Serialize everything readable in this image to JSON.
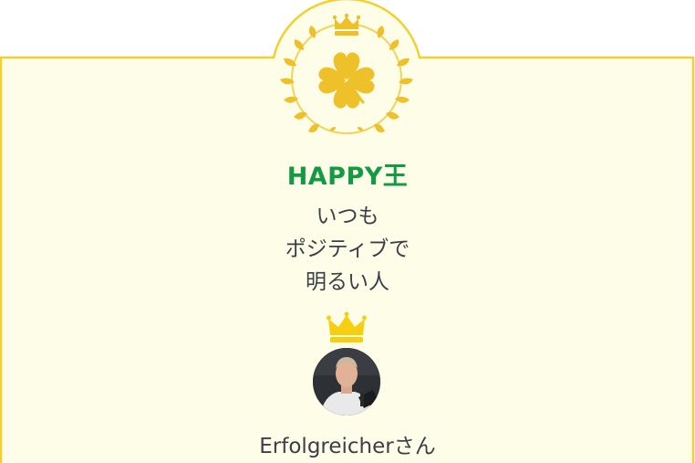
{
  "award": {
    "title": "HAPPY王",
    "description_lines": [
      "いつも",
      "ポジティブで",
      "明るい人"
    ]
  },
  "winner": {
    "name": "Erfolgreicherさん"
  },
  "colors": {
    "card_background": "#fdfde8",
    "card_border": "#f2d032",
    "title_green": "#149a45",
    "emblem_gold": "#eec12a",
    "crown_yellow": "#f5cf10",
    "text_dark": "#3a3f48"
  },
  "icons": {
    "emblem": "clover-laurel-emblem-icon",
    "emblem_crown": "crown-icon",
    "winner_crown": "crown-icon"
  }
}
